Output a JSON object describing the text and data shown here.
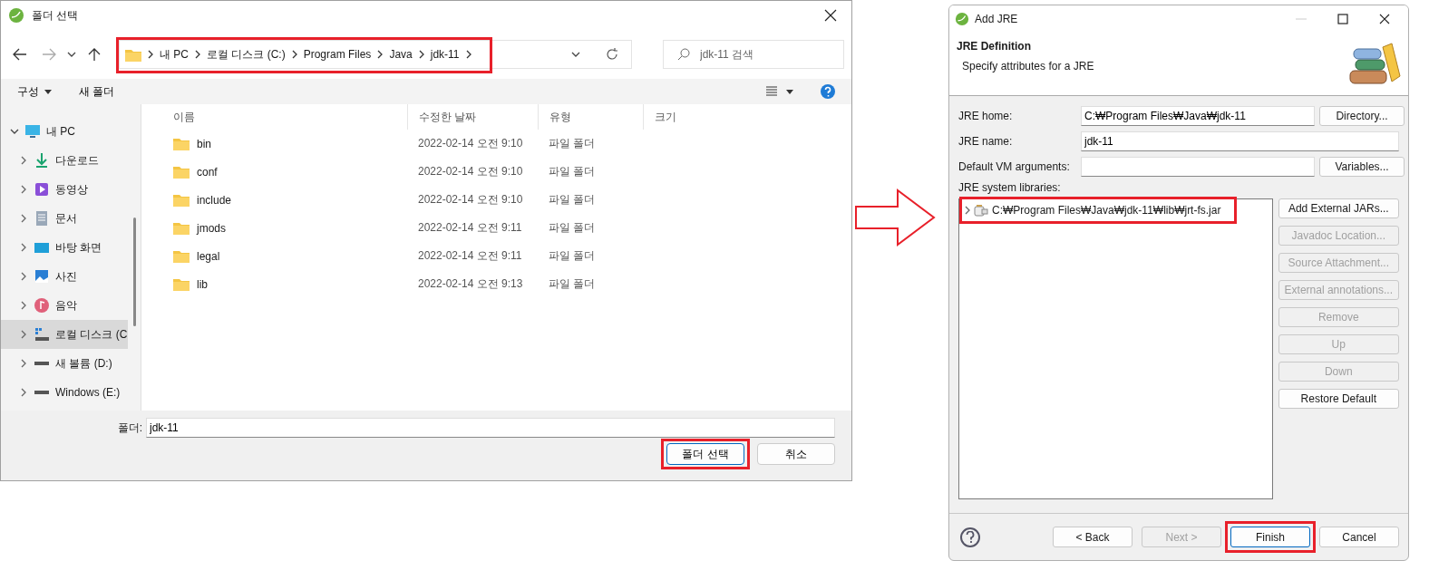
{
  "folder_dialog": {
    "title": "폴더 선택",
    "address": {
      "highlighted": true,
      "segments": [
        "내 PC",
        "로컬 디스크 (C:)",
        "Program Files",
        "Java",
        "jdk-11"
      ]
    },
    "search": {
      "placeholder": "jdk-11 검색"
    },
    "toolbar": [
      "구성",
      "새 폴더"
    ],
    "sidebar": [
      {
        "label": "내 PC",
        "kind": "pc",
        "expanded": true,
        "selected": false,
        "children": [
          {
            "label": "다운로드",
            "kind": "download",
            "expanded": false,
            "selected": false
          },
          {
            "label": "동영상",
            "kind": "video",
            "expanded": false,
            "selected": false
          },
          {
            "label": "문서",
            "kind": "document",
            "expanded": false,
            "selected": false
          },
          {
            "label": "바탕 화면",
            "kind": "desktop",
            "expanded": false,
            "selected": false
          },
          {
            "label": "사진",
            "kind": "photo",
            "expanded": false,
            "selected": false
          },
          {
            "label": "음악",
            "kind": "music",
            "expanded": false,
            "selected": false
          },
          {
            "label": "로컬 디스크 (C",
            "kind": "system_disk",
            "expanded": false,
            "selected": true
          },
          {
            "label": "새 볼륨 (D:)",
            "kind": "drive",
            "expanded": false,
            "selected": false
          },
          {
            "label": "Windows (E:)",
            "kind": "drive",
            "expanded": false,
            "selected": false
          }
        ]
      }
    ],
    "columns": [
      "이름",
      "수정한 날짜",
      "유형",
      "크기"
    ],
    "rows": [
      {
        "name": "bin",
        "modified": "2022-02-14 오전 9:10",
        "type": "파일 폴더"
      },
      {
        "name": "conf",
        "modified": "2022-02-14 오전 9:10",
        "type": "파일 폴더"
      },
      {
        "name": "include",
        "modified": "2022-02-14 오전 9:10",
        "type": "파일 폴더"
      },
      {
        "name": "jmods",
        "modified": "2022-02-14 오전 9:11",
        "type": "파일 폴더"
      },
      {
        "name": "legal",
        "modified": "2022-02-14 오전 9:11",
        "type": "파일 폴더"
      },
      {
        "name": "lib",
        "modified": "2022-02-14 오전 9:13",
        "type": "파일 폴더"
      }
    ],
    "folder_field": {
      "label": "폴더:",
      "value": "jdk-11"
    },
    "buttons": [
      {
        "label": "폴더 선택",
        "highlighted": true,
        "default": true
      },
      {
        "label": "취소",
        "highlighted": false,
        "default": false
      }
    ]
  },
  "jre_dialog": {
    "title": "Add JRE",
    "header": {
      "title": "JRE Definition",
      "subtitle": "Specify attributes for a JRE"
    },
    "fields": [
      {
        "label": "JRE home:",
        "value": "C:₩Program Files₩Java₩jdk-11",
        "button": "Directory..."
      },
      {
        "label": "JRE name:",
        "value": "jdk-11"
      },
      {
        "label": "Default VM arguments:",
        "button": "Variables..."
      }
    ],
    "libraries_label": "JRE system libraries:",
    "libraries": [
      {
        "label": "C:₩Program Files₩Java₩jdk-11₩lib₩jrt-fs.jar",
        "expanded": false,
        "highlighted": true
      }
    ],
    "side_buttons": [
      {
        "label": "Add External JARs...",
        "disabled": false
      },
      {
        "label": "Javadoc Location...",
        "disabled": true
      },
      {
        "label": "Source Attachment...",
        "disabled": true
      },
      {
        "label": "External annotations...",
        "disabled": true
      },
      {
        "label": "Remove",
        "disabled": true
      },
      {
        "label": "Up",
        "disabled": true
      },
      {
        "label": "Down",
        "disabled": true
      },
      {
        "label": "Restore Default",
        "disabled": false
      }
    ],
    "footer_buttons": [
      {
        "label": "< Back",
        "disabled": false,
        "highlighted": false,
        "default": false
      },
      {
        "label": "Next >",
        "disabled": true,
        "highlighted": false,
        "default": false
      },
      {
        "label": "Finish",
        "disabled": false,
        "highlighted": true,
        "default": true
      },
      {
        "label": "Cancel",
        "disabled": false,
        "highlighted": false,
        "default": false
      }
    ]
  }
}
